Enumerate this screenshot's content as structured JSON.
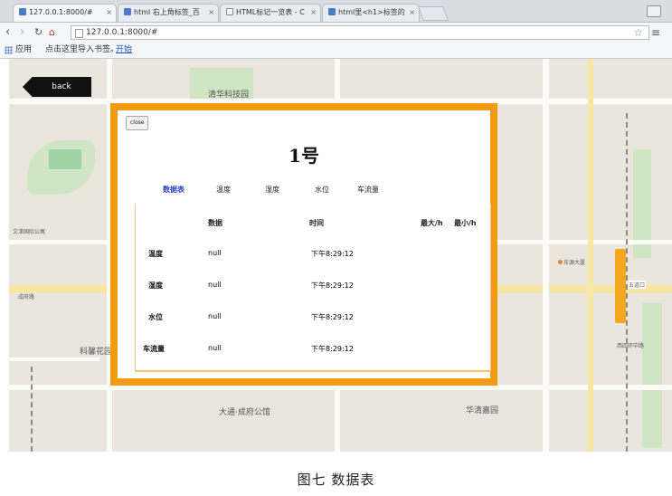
{
  "browser": {
    "tabs": [
      {
        "label": "127.0.0.1:8000/#"
      },
      {
        "label": "html 右上角标签_百"
      },
      {
        "label": "HTML标记一览表 - C"
      },
      {
        "label": "html里<h1>标签的"
      }
    ],
    "address": "127.0.0.1:8000/#",
    "bookmarks_bar": {
      "apps": "应用",
      "import": "点击这里导入书签。",
      "start": "开始"
    }
  },
  "map": {
    "back_label": "back",
    "labels": [
      {
        "text": "清华科技园"
      },
      {
        "text": "文津国际公寓"
      },
      {
        "text": "成府路"
      },
      {
        "text": "科馨花园"
      },
      {
        "text": "大通·成府公馆"
      },
      {
        "text": "华清嘉园"
      },
      {
        "text": "五道口"
      },
      {
        "text": "东源大厦"
      },
      {
        "text": "西四环中路"
      }
    ]
  },
  "modal": {
    "close_label": "close",
    "title": "1号",
    "tabs": [
      "数据表",
      "温度",
      "湿度",
      "水位",
      "车流量"
    ],
    "active_tab": "数据表",
    "table": {
      "columns": [
        "数据",
        "时间",
        "最大/h",
        "最小/h"
      ],
      "rows": [
        {
          "label": "温度",
          "value": "null",
          "time": "下午8:29:12"
        },
        {
          "label": "湿度",
          "value": "null",
          "time": "下午8:29:12"
        },
        {
          "label": "水位",
          "value": "null",
          "time": "下午8:29:12"
        },
        {
          "label": "车流量",
          "value": "null",
          "time": "下午8:29:12"
        }
      ]
    }
  },
  "caption": "图七 数据表",
  "colors": {
    "modal_border": "#f39b12",
    "active_tab": "#2a3ec9",
    "metro": "#f3a820"
  }
}
